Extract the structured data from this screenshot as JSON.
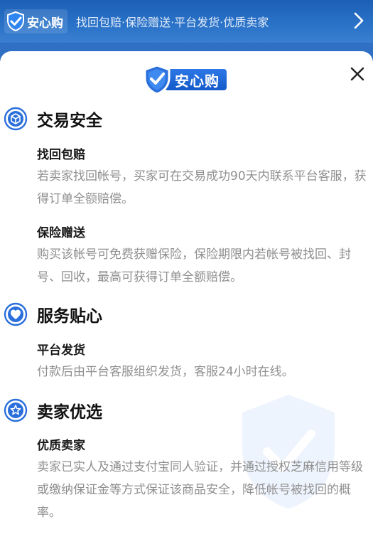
{
  "banner": {
    "badge_text": "安心购",
    "slogan": "找回包赔·保险赠送·平台发货·优质卖家"
  },
  "panel": {
    "logo_text": "安心购",
    "sections": [
      {
        "title": "交易安全",
        "icon": "cube-icon",
        "items": [
          {
            "title": "找回包赔",
            "desc": "若卖家找回帐号，买家可在交易成功90天内联系平台客服，获得订单全额赔偿。"
          },
          {
            "title": "保险赠送",
            "desc": "购买该帐号可免费获赠保险，保险期限内若帐号被找回、封号、回收，最高可获得订单全额赔偿。"
          }
        ]
      },
      {
        "title": "服务贴心",
        "icon": "heart-icon",
        "items": [
          {
            "title": "平台发货",
            "desc": "付款后由平台客服组织发货，客服24小时在线。"
          }
        ]
      },
      {
        "title": "卖家优选",
        "icon": "star-icon",
        "items": [
          {
            "title": "优质卖家",
            "desc": "卖家已实人及通过支付宝同人验证，并通过授权芝麻信用等级或缴纳保证金等方式保证该商品安全，降低帐号被找回的概率。"
          }
        ]
      }
    ]
  },
  "colors": {
    "accent": "#2a6fdb",
    "banner": "#2a73c9",
    "desc_text": "#8f8f8f"
  }
}
